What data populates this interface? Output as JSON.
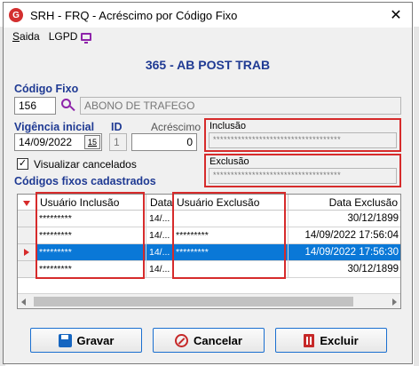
{
  "window": {
    "app_icon_letter": "G",
    "title": "SRH - FRQ - Acréscimo por Código Fixo",
    "close_glyph": "✕"
  },
  "menu": {
    "saida_label": "Saida",
    "saida_mnemonic": "S",
    "lgpd_label": "LGPD"
  },
  "header": {
    "title": "365 - AB POST TRAB"
  },
  "codigo_fixo": {
    "label": "Código Fixo",
    "code": "156",
    "description": "ABONO DE TRAFEGO"
  },
  "vigencia": {
    "label": "Vigência inicial",
    "value": "14/09/2022",
    "calendar_button": "15"
  },
  "id_field": {
    "label": "ID",
    "value": "1"
  },
  "acrescimo": {
    "label": "Acréscimo",
    "value": "0"
  },
  "inclusao": {
    "label": "Inclusão",
    "value": "************************************"
  },
  "exclusao": {
    "label": "Exclusão",
    "value": "************************************"
  },
  "visualizar_cancelados": {
    "label": "Visualizar cancelados",
    "checked": true,
    "check_glyph": "✓"
  },
  "grid": {
    "section_label": "Códigos fixos cadastrados",
    "columns": {
      "usuario_inclusao": "Usuário Inclusão",
      "data": "Data",
      "usuario_exclusao": "Usuário Exclusão",
      "data_exclusao": "Data Exclusão"
    },
    "rows": [
      {
        "usuario_inclusao": "*********",
        "data": "14/...",
        "usuario_exclusao": "",
        "data_exclusao": "30/12/1899",
        "selected": false
      },
      {
        "usuario_inclusao": "*********",
        "data": "14/...",
        "usuario_exclusao": "*********",
        "data_exclusao": "14/09/2022 17:56:04",
        "selected": false
      },
      {
        "usuario_inclusao": "*********",
        "data": "14/...",
        "usuario_exclusao": "*********",
        "data_exclusao": "14/09/2022 17:56:30",
        "selected": true
      },
      {
        "usuario_inclusao": "*********",
        "data": "14/...",
        "usuario_exclusao": "",
        "data_exclusao": "30/12/1899",
        "selected": false
      }
    ]
  },
  "buttons": {
    "gravar": "Gravar",
    "cancelar": "Cancelar",
    "excluir": "Excluir"
  },
  "colors": {
    "accent_blue": "#1f3a93",
    "highlight_red": "#d62b2b",
    "selection_blue": "#0a78d7",
    "icon_purple": "#8e24aa"
  }
}
